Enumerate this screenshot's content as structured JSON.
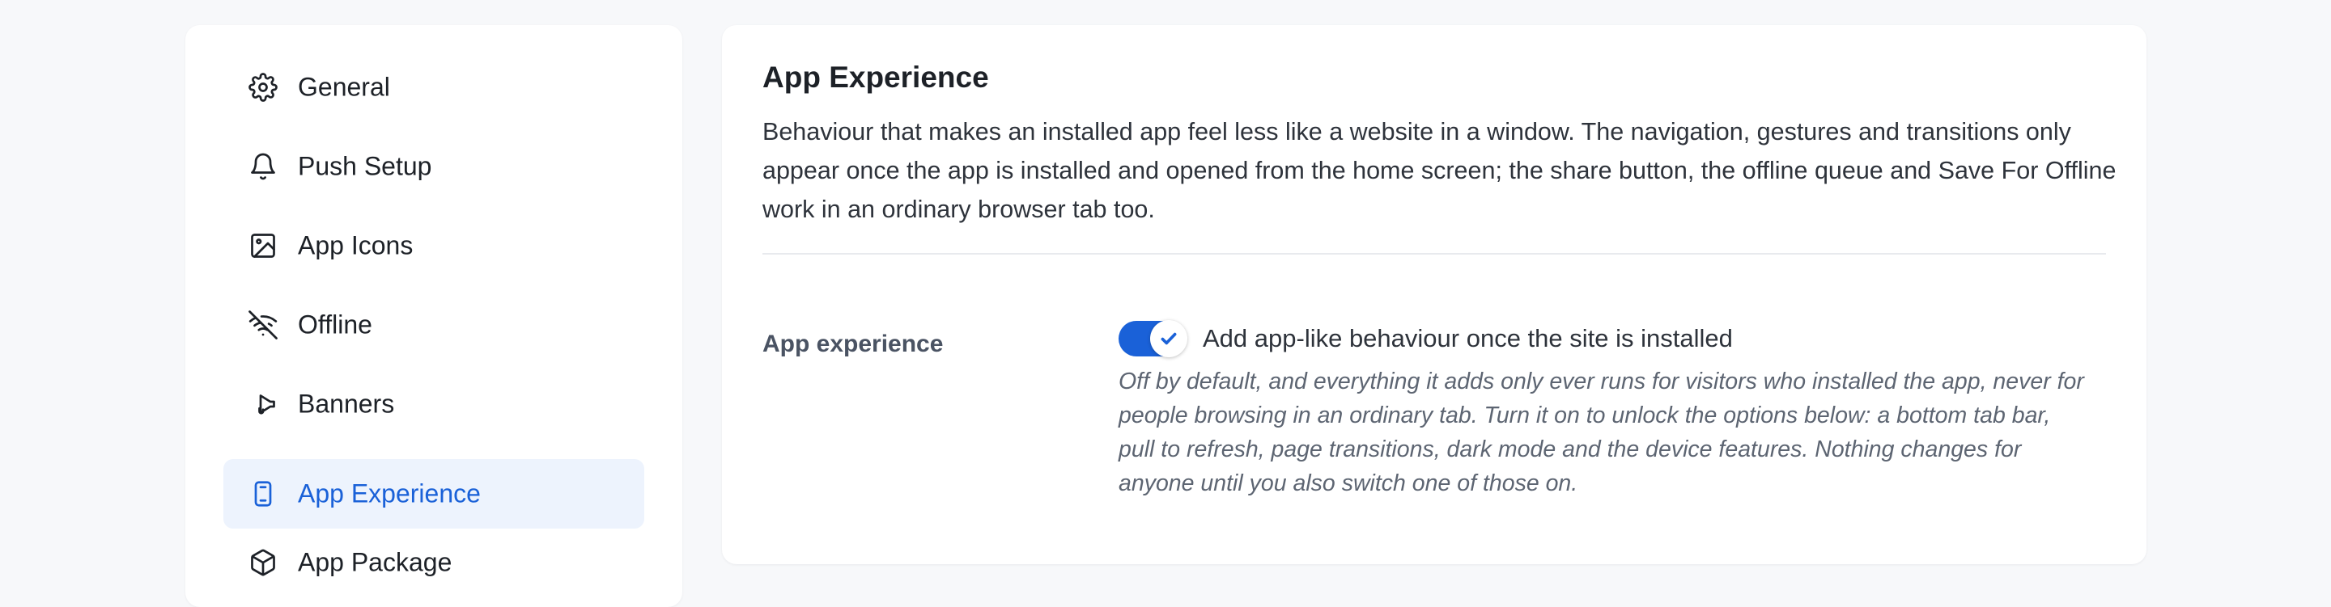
{
  "sidebar": {
    "items": [
      {
        "label": "General",
        "icon": "gear-icon",
        "active": false
      },
      {
        "label": "Push Setup",
        "icon": "bell-icon",
        "active": false
      },
      {
        "label": "App Icons",
        "icon": "image-icon",
        "active": false
      },
      {
        "label": "Offline",
        "icon": "wifi-off-icon",
        "active": false
      },
      {
        "label": "Banners",
        "icon": "megaphone-icon",
        "active": false
      },
      {
        "label": "App Experience",
        "icon": "phone-icon",
        "active": true
      },
      {
        "label": "App Package",
        "icon": "box-icon",
        "active": false
      }
    ]
  },
  "panel": {
    "title": "App Experience",
    "description": "Behaviour that makes an installed app feel less like a website in a window. The navigation, gestures and transitions only appear once the app is installed and opened from the home screen; the share button, the offline queue and Save For Offline work in an ordinary browser tab too.",
    "setting": {
      "label": "App experience",
      "toggle_on": true,
      "toggle_label": "Add app-like behaviour once the site is installed",
      "help": "Off by default, and everything it adds only ever runs for visitors who installed the app, never for people browsing in an ordinary tab. Turn it on to unlock the options below: a bottom tab bar, pull to refresh, page transitions, dark mode and the device features. Nothing changes for anyone until you also switch one of those on."
    }
  },
  "colors": {
    "accent": "#1a61d8",
    "active_bg": "#edf3fd",
    "page_bg": "#f7f8fa",
    "card_bg": "#ffffff"
  }
}
